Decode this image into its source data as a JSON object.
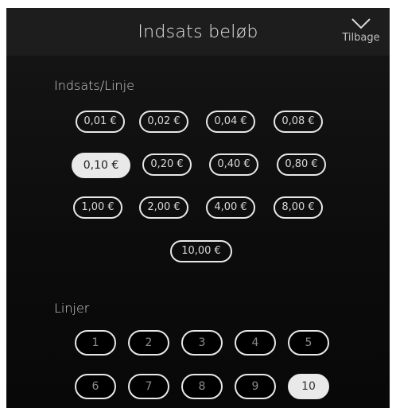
{
  "header": {
    "title": "Indsats beløb",
    "back_label": "Tilbage"
  },
  "bet_section": {
    "label": "Indsats/Linje",
    "options": [
      "0,01 €",
      "0,02 €",
      "0,04 €",
      "0,08 €",
      "0,10 €",
      "0,20 €",
      "0,40 €",
      "0,80 €",
      "1,00 €",
      "2,00 €",
      "4,00 €",
      "8,00 €",
      "10,00 €"
    ],
    "selected": "0,10 €"
  },
  "lines_section": {
    "label": "Linjer",
    "options": [
      "1",
      "2",
      "3",
      "4",
      "5",
      "6",
      "7",
      "8",
      "9",
      "10"
    ],
    "selected": "10"
  },
  "colors": {
    "panel_background": "#0c0c0c",
    "header_background": "#1d1d1d",
    "button_border": "#e8e8e8",
    "selected_background": "#e9e9e9"
  },
  "icons": {
    "back": "chevron-down-icon"
  }
}
